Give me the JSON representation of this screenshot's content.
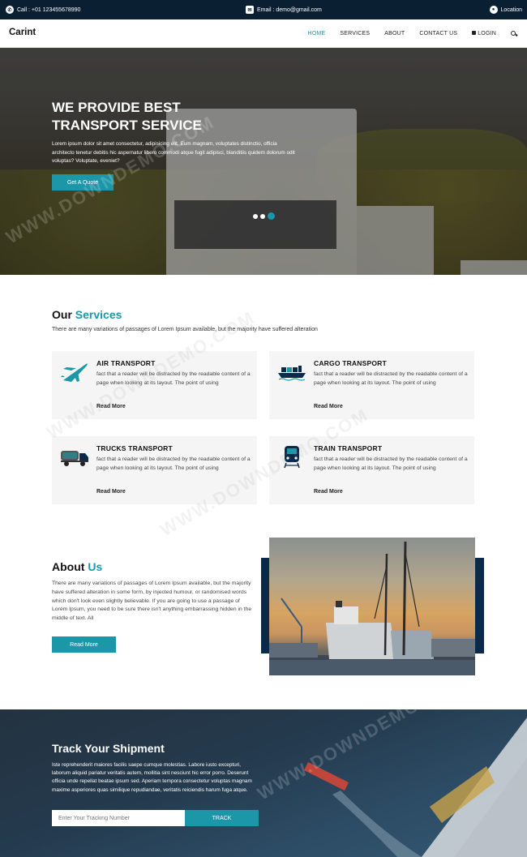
{
  "topbar": {
    "phone": "Call : +01 123455678990",
    "email": "Email : demo@gmail.com",
    "location": "Location"
  },
  "nav": {
    "logo": "Carint",
    "items": [
      "HOME",
      "SERVICES",
      "ABOUT",
      "CONTACT US",
      "LOGIN"
    ],
    "active": "HOME"
  },
  "hero": {
    "title_line1": "WE PROVIDE BEST",
    "title_line2": "TRANSPORT SERVICE",
    "text": "Lorem ipsum dolor sit amet consectetur, adipisicing elit. Eum magnam, voluptates distinctio, officia architecto tenetur debitis hic aspernatur libero commodi atque fugit adipisci, blanditiis quidem dolorum odit voluptas? Voluptate, eveniet?",
    "button": "Get A Quote",
    "slides_active": 3
  },
  "services": {
    "title_a": "Our",
    "title_b": "Services",
    "subtitle": "There are many variations of passages of Lorem Ipsum available, but the majority have suffered alteration",
    "cards": [
      {
        "title": "AIR TRANSPORT",
        "text": "fact that a reader will be distracted by the readable content of a page when looking at its layout. The point of using",
        "link": "Read More",
        "icon": "airplane-icon"
      },
      {
        "title": "CARGO TRANSPORT",
        "text": "fact that a reader will be distracted by the readable content of a page when looking at its layout. The point of using",
        "link": "Read More",
        "icon": "cargo-ship-icon"
      },
      {
        "title": "TRUCKS TRANSPORT",
        "text": "fact that a reader will be distracted by the readable content of a page when looking at its layout. The point of using",
        "link": "Read More",
        "icon": "truck-icon"
      },
      {
        "title": "TRAIN TRANSPORT",
        "text": "fact that a reader will be distracted by the readable content of a page when looking at its layout. The point of using",
        "link": "Read More",
        "icon": "train-icon"
      }
    ]
  },
  "about": {
    "title_a": "About",
    "title_b": "Us",
    "text": "There are many variations of passages of Lorem Ipsum available, but the majority have suffered alteration in some form, by injected humour, or randomised words which don't look even slightly believable. If you are going to use a passage of Lorem Ipsum, you need to be sure there isn't anything embarrassing hidden in the middle of text. All",
    "button": "Read More"
  },
  "track": {
    "title": "Track Your Shipment",
    "text": "Iste reprehenderit maiores facilis saepe cumque molestias. Labore iusto excepturi, laborum aliquid pariatur veritatis autem, mollitia sint nesciunt hic error porro. Deserunt officia unde repellat beatae ipsum sed. Aperiam tempora consectetur voluptas magnam maxime asperiores quas similique repudiandae, veritatis reiciendis harum fuga atque.",
    "placeholder": "Enter Your Tracking Number",
    "button": "TRACK"
  },
  "watermark": "WWW.DOWNDEMO.COM",
  "colors": {
    "accent": "#1b97a8",
    "topbar": "#0b1f33",
    "about_block": "#0b2a4a"
  }
}
